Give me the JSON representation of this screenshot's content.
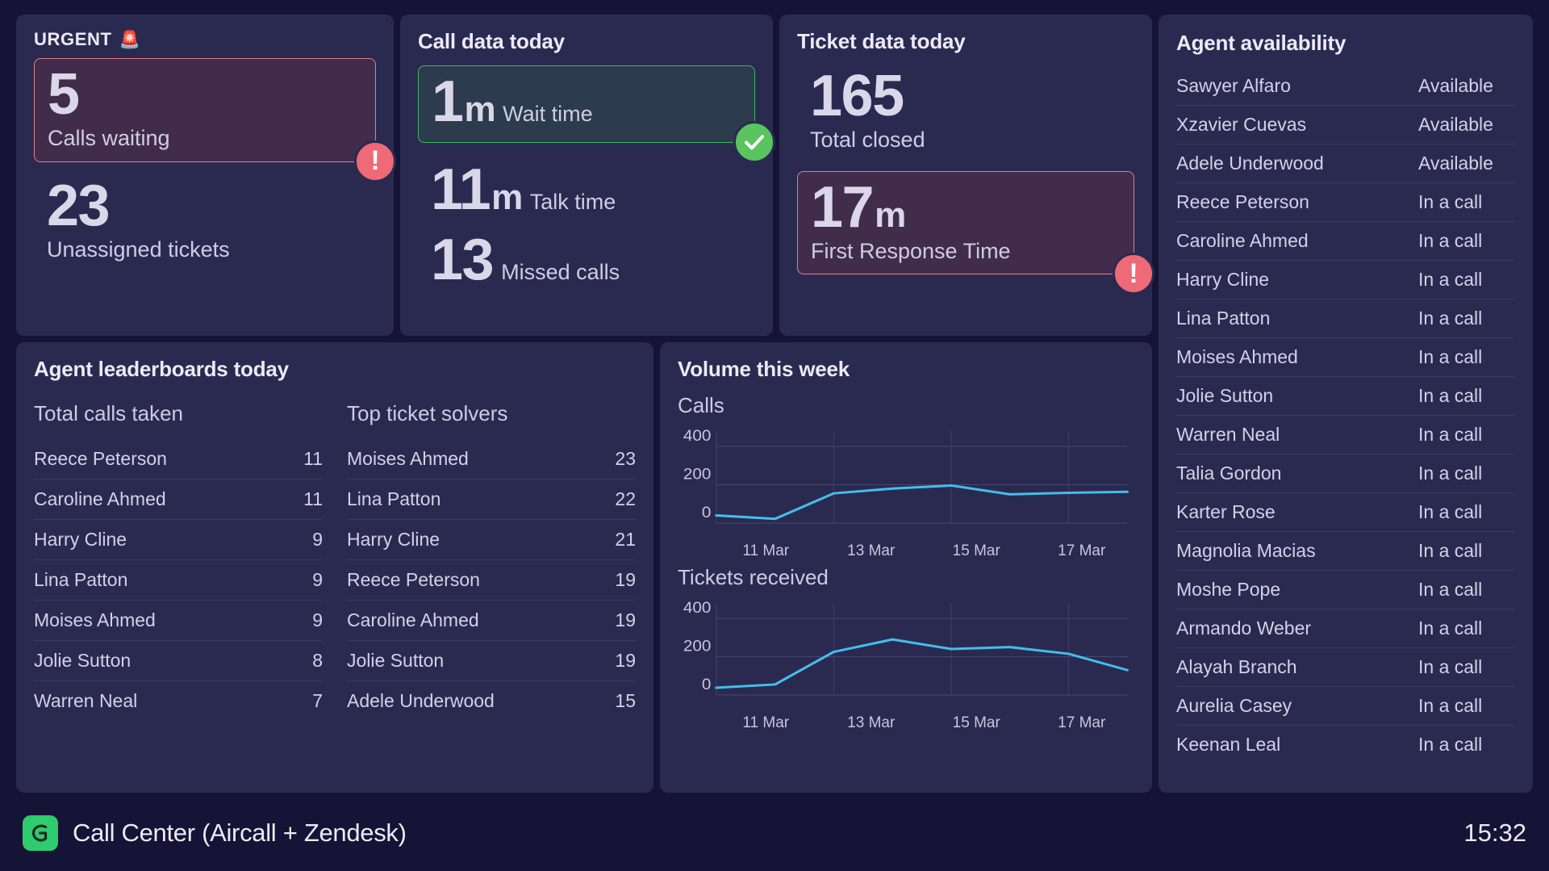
{
  "urgent": {
    "title": "URGENT",
    "siren_icon": "rotating-light-icon",
    "calls_waiting_value": "5",
    "calls_waiting_label": "Calls waiting",
    "unassigned_value": "23",
    "unassigned_label": "Unassigned tickets",
    "alert_badge": "!"
  },
  "call_data": {
    "title": "Call data today",
    "wait_value": "1",
    "wait_unit": "m",
    "wait_label": "Wait time",
    "talk_value": "11",
    "talk_unit": "m",
    "talk_label": "Talk time",
    "missed_value": "13",
    "missed_label": "Missed calls",
    "ok_badge": "check-icon"
  },
  "ticket_data": {
    "title": "Ticket data today",
    "closed_value": "165",
    "closed_label": "Total closed",
    "frt_value": "17",
    "frt_unit": "m",
    "frt_label": "First Response Time",
    "alert_badge": "!"
  },
  "agent_availability": {
    "title": "Agent availability",
    "rows": [
      {
        "name": "Sawyer Alfaro",
        "status": "Available"
      },
      {
        "name": "Xzavier Cuevas",
        "status": "Available"
      },
      {
        "name": "Adele Underwood",
        "status": "Available"
      },
      {
        "name": "Reece Peterson",
        "status": "In a call"
      },
      {
        "name": "Caroline Ahmed",
        "status": "In a call"
      },
      {
        "name": "Harry Cline",
        "status": "In a call"
      },
      {
        "name": "Lina Patton",
        "status": "In a call"
      },
      {
        "name": "Moises Ahmed",
        "status": "In a call"
      },
      {
        "name": "Jolie Sutton",
        "status": "In a call"
      },
      {
        "name": "Warren Neal",
        "status": "In a call"
      },
      {
        "name": "Talia Gordon",
        "status": "In a call"
      },
      {
        "name": "Karter Rose",
        "status": "In a call"
      },
      {
        "name": "Magnolia Macias",
        "status": "In a call"
      },
      {
        "name": "Moshe Pope",
        "status": "In a call"
      },
      {
        "name": "Armando Weber",
        "status": "In a call"
      },
      {
        "name": "Alayah Branch",
        "status": "In a call"
      },
      {
        "name": "Aurelia Casey",
        "status": "In a call"
      },
      {
        "name": "Keenan Leal",
        "status": "In a call"
      }
    ]
  },
  "leaderboards": {
    "title": "Agent leaderboards today",
    "columns": [
      {
        "heading": "Total calls taken",
        "rows": [
          {
            "name": "Reece Peterson",
            "value": "11"
          },
          {
            "name": "Caroline Ahmed",
            "value": "11"
          },
          {
            "name": "Harry Cline",
            "value": "9"
          },
          {
            "name": "Lina Patton",
            "value": "9"
          },
          {
            "name": "Moises Ahmed",
            "value": "9"
          },
          {
            "name": "Jolie Sutton",
            "value": "8"
          },
          {
            "name": "Warren Neal",
            "value": "7"
          }
        ]
      },
      {
        "heading": "Top ticket solvers",
        "rows": [
          {
            "name": "Moises Ahmed",
            "value": "23"
          },
          {
            "name": "Lina Patton",
            "value": "22"
          },
          {
            "name": "Harry Cline",
            "value": "21"
          },
          {
            "name": "Reece Peterson",
            "value": "19"
          },
          {
            "name": "Caroline Ahmed",
            "value": "19"
          },
          {
            "name": "Jolie Sutton",
            "value": "19"
          },
          {
            "name": "Adele Underwood",
            "value": "15"
          }
        ]
      }
    ]
  },
  "volume": {
    "title": "Volume this week"
  },
  "chart_data": [
    {
      "type": "line",
      "title": "Calls",
      "xlabel": "",
      "ylabel": "",
      "ylim": [
        0,
        480
      ],
      "yticks": [
        0,
        200,
        400
      ],
      "ytick_labels": [
        "0",
        "200",
        "400"
      ],
      "grid": true,
      "legend": "none",
      "series_color": "#45bdec",
      "x": [
        "11 Mar",
        "12 Mar",
        "13 Mar",
        "14 Mar",
        "15 Mar",
        "16 Mar",
        "17 Mar",
        "18 Mar"
      ],
      "xtick_labels": [
        "11 Mar",
        "13 Mar",
        "15 Mar",
        "17 Mar"
      ],
      "values": [
        40,
        22,
        155,
        180,
        196,
        150,
        158,
        163
      ]
    },
    {
      "type": "line",
      "title": "Tickets received",
      "xlabel": "",
      "ylabel": "",
      "ylim": [
        0,
        480
      ],
      "yticks": [
        0,
        200,
        400
      ],
      "ytick_labels": [
        "0",
        "200",
        "400"
      ],
      "grid": true,
      "legend": "none",
      "series_color": "#45bdec",
      "x": [
        "11 Mar",
        "12 Mar",
        "13 Mar",
        "14 Mar",
        "15 Mar",
        "16 Mar",
        "17 Mar",
        "18 Mar"
      ],
      "xtick_labels": [
        "11 Mar",
        "13 Mar",
        "15 Mar",
        "17 Mar"
      ],
      "values": [
        38,
        55,
        225,
        290,
        240,
        250,
        215,
        130
      ]
    }
  ],
  "footer": {
    "logo_icon": "geckoboard-logo-icon",
    "title": "Call Center (Aircall + Zendesk)",
    "time": "15:32"
  }
}
